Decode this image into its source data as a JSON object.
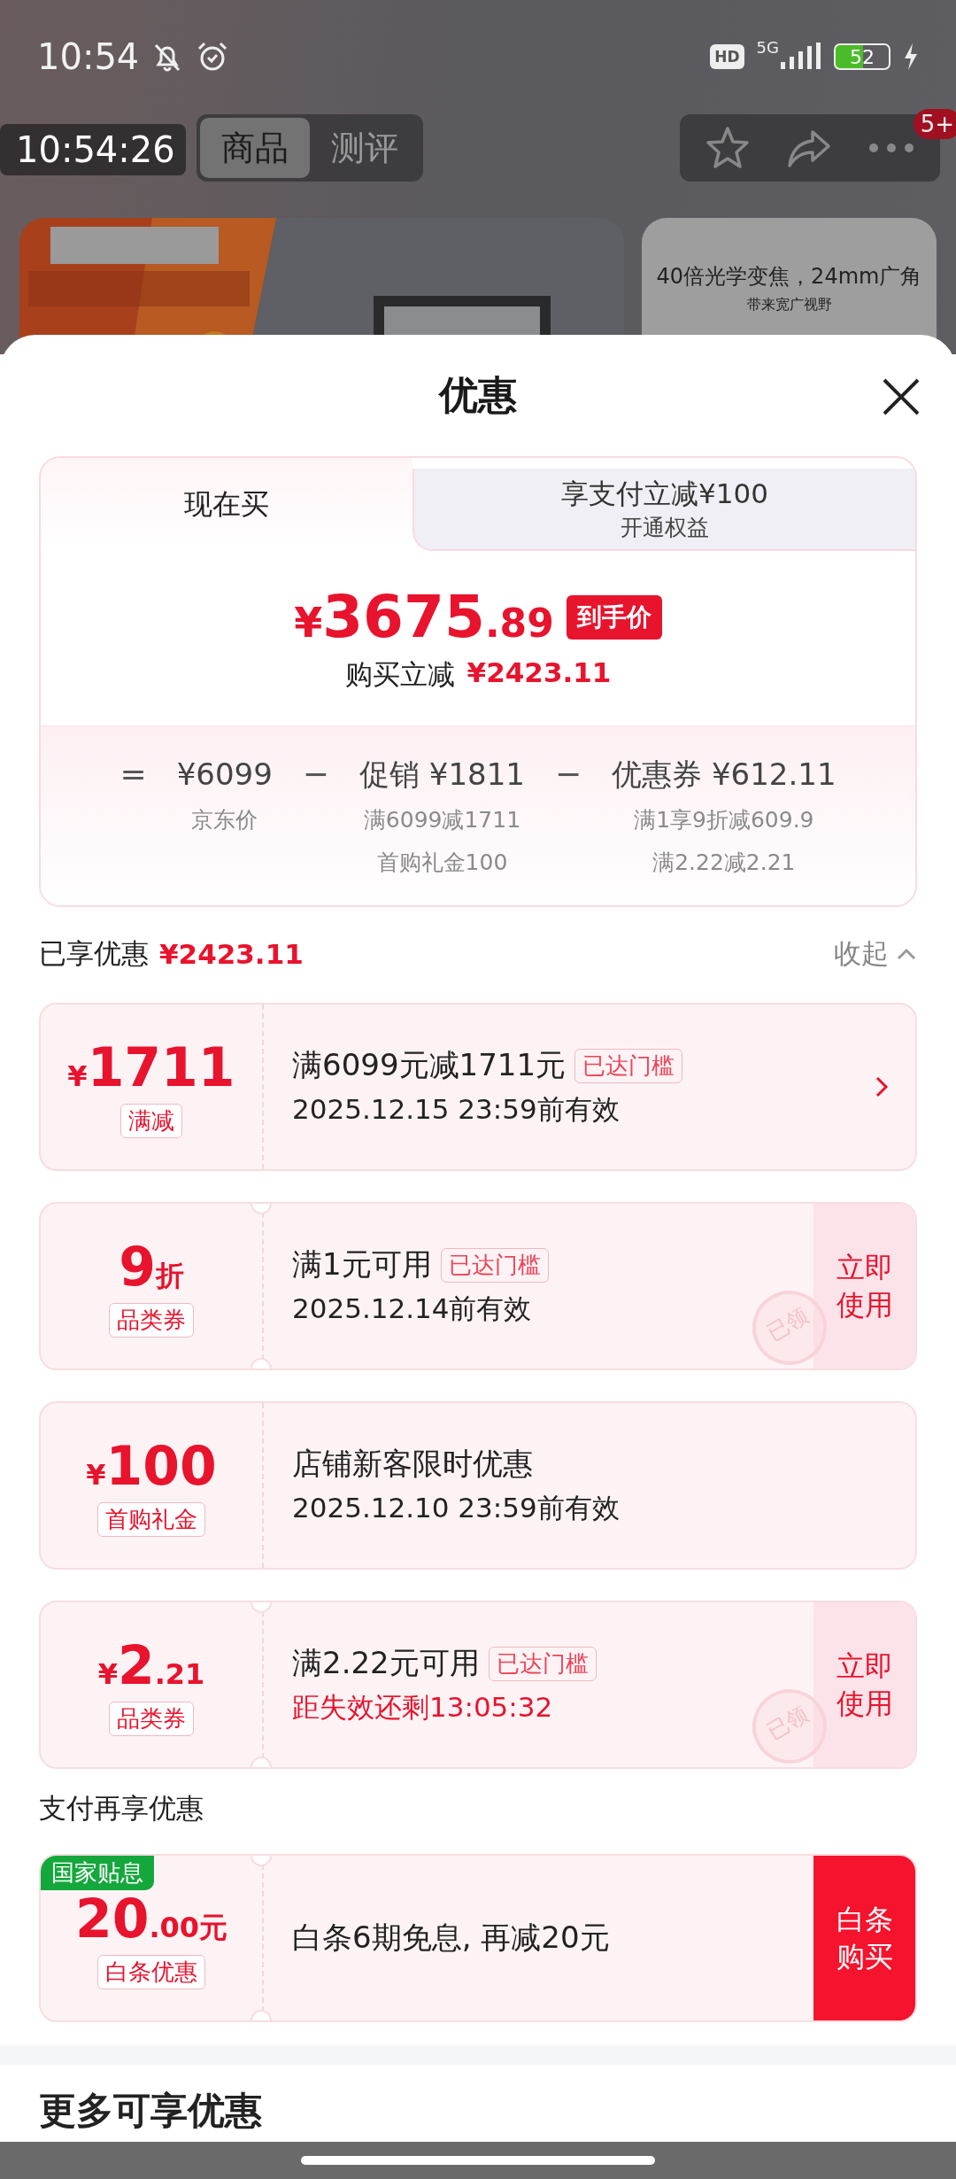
{
  "status_bar": {
    "time": "10:54",
    "hd": "HD",
    "network": "5G",
    "battery": "52"
  },
  "recorder_clock": "10:54:26",
  "top_nav": {
    "tabs": [
      {
        "label": "商品",
        "selected": true
      },
      {
        "label": "测评",
        "selected": false
      }
    ],
    "badge": "5+"
  },
  "feature_card": {
    "title": "40倍光学变焦，24mm广角",
    "subtitle": "带来宽广视野"
  },
  "sheet": {
    "title": "优惠",
    "price_tabs": [
      {
        "label": "现在买",
        "selected": true
      },
      {
        "label": "享支付立减¥100",
        "sublabel": "开通权益",
        "selected": false
      }
    ],
    "final_price": {
      "currency": "¥",
      "integer": "3675",
      "decimal": ".89",
      "tag": "到手价"
    },
    "discount_line": {
      "label": "购买立减",
      "amount": "¥2423.11"
    },
    "breakdown": [
      {
        "operator": "=",
        "value": "¥6099",
        "notes": [
          "京东价"
        ]
      },
      {
        "operator": "−",
        "label": "促销",
        "value": "¥1811",
        "notes": [
          "满6099减1711",
          "首购礼金100"
        ]
      },
      {
        "operator": "−",
        "label": "优惠券",
        "value": "¥612.11",
        "notes": [
          "满1享9折减609.9",
          "满2.22减2.21"
        ]
      }
    ],
    "enjoyed": {
      "label": "已享优惠",
      "amount": "¥2423.11",
      "toggle": "收起",
      "expanded": true
    },
    "coupons": [
      {
        "kind": "link",
        "prefix": "¥",
        "main": "1711",
        "tag": "满减",
        "title": "满6099元减1711元",
        "badge": "已达门槛",
        "validity": "2025.12.15 23:59前有效",
        "urgent": false
      },
      {
        "kind": "claimable",
        "main": "9",
        "suffix": "折",
        "tag": "品类券",
        "title": "满1元可用",
        "badge": "已达门槛",
        "validity": "2025.12.14前有效",
        "urgent": false,
        "action": "立即使用",
        "stamp": "已领"
      },
      {
        "kind": "plain",
        "prefix": "¥",
        "main": "100",
        "tag": "首购礼金",
        "title": "店铺新客限时优惠",
        "validity": "2025.12.10 23:59前有效",
        "urgent": false
      },
      {
        "kind": "claimable",
        "prefix": "¥",
        "main": "2",
        "suffix": ".21",
        "tag": "品类券",
        "title": "满2.22元可用",
        "badge": "已达门槛",
        "validity": "距失效还剩13:05:32",
        "urgent": true,
        "action": "立即使用",
        "stamp": "已领"
      }
    ],
    "payment_section": {
      "title": "支付再享优惠",
      "offers": [
        {
          "kind": "payment",
          "ribbon": "国家贴息",
          "main": "20",
          "suffix": ".00元",
          "tag": "白条优惠",
          "title": "白条6期免息, 再减20元",
          "action": "白条购买"
        }
      ]
    },
    "more_section": {
      "title": "更多可享优惠"
    }
  }
}
